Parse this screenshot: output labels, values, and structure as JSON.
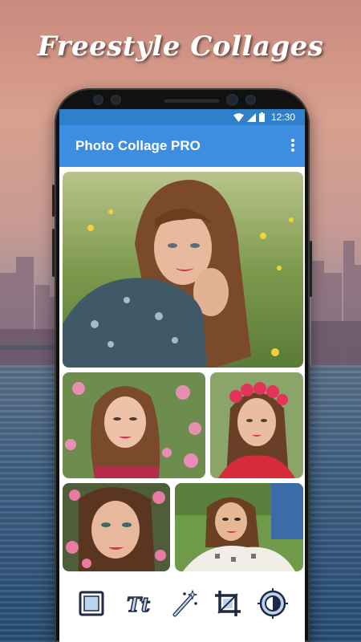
{
  "promo": {
    "headline": "Freestyle Collages"
  },
  "statusbar": {
    "time": "12:30"
  },
  "app": {
    "title": "Photo Collage PRO"
  },
  "colors": {
    "appbar": "#3d8ee0",
    "statusbar": "#2f7fc9",
    "accent": "#3d8ee0"
  },
  "toolbar": {
    "tools": [
      {
        "icon": "frame-icon"
      },
      {
        "icon": "text-icon"
      },
      {
        "icon": "magic-wand-icon"
      },
      {
        "icon": "crop-icon"
      },
      {
        "icon": "adjust-icon"
      }
    ]
  }
}
